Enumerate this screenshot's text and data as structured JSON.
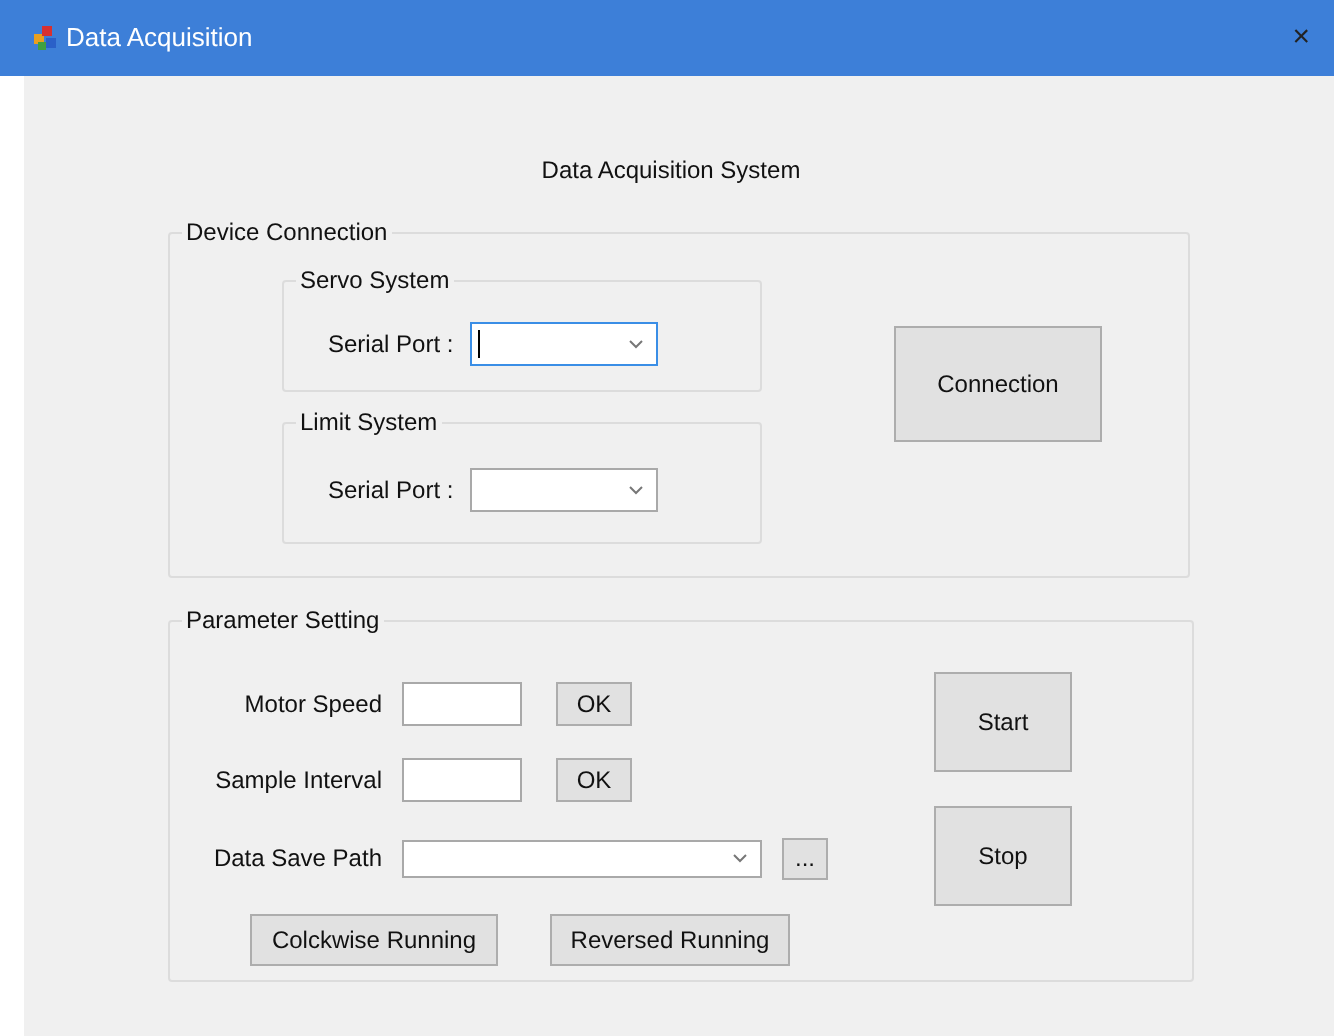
{
  "window": {
    "title": "Data Acquisition",
    "close": "×"
  },
  "heading": "Data Acquisition System",
  "device_connection": {
    "title": "Device Connection",
    "groups": [
      {
        "title": "Servo System",
        "label": "Serial Port :",
        "focused": true
      },
      {
        "title": "Limit System",
        "label": "Serial Port :",
        "focused": false
      }
    ],
    "button": "Connection"
  },
  "parameter_setting": {
    "title": "Parameter Setting",
    "rows": [
      {
        "kind": "text",
        "label": "Motor Speed",
        "button": "OK"
      },
      {
        "kind": "text",
        "label": "Sample Interval",
        "button": "OK"
      },
      {
        "kind": "combo",
        "label": "Data Save Path",
        "button": "..."
      }
    ],
    "run_buttons": [
      "Colckwise Running",
      "Reversed Running"
    ],
    "start": "Start",
    "stop": "Stop"
  }
}
